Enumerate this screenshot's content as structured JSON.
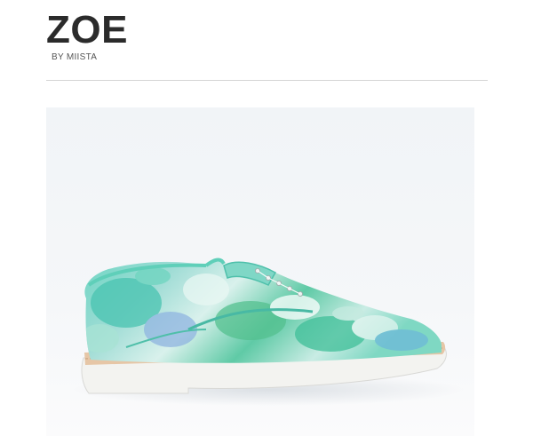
{
  "brand": {
    "title": "ZOE",
    "subtitle": "BY MIISTA"
  },
  "product_image": {
    "icon": "shoe-image",
    "accent": "#6fd3c2",
    "sole_color": "#f2f2ef",
    "welt_color": "#e4c3a3"
  }
}
